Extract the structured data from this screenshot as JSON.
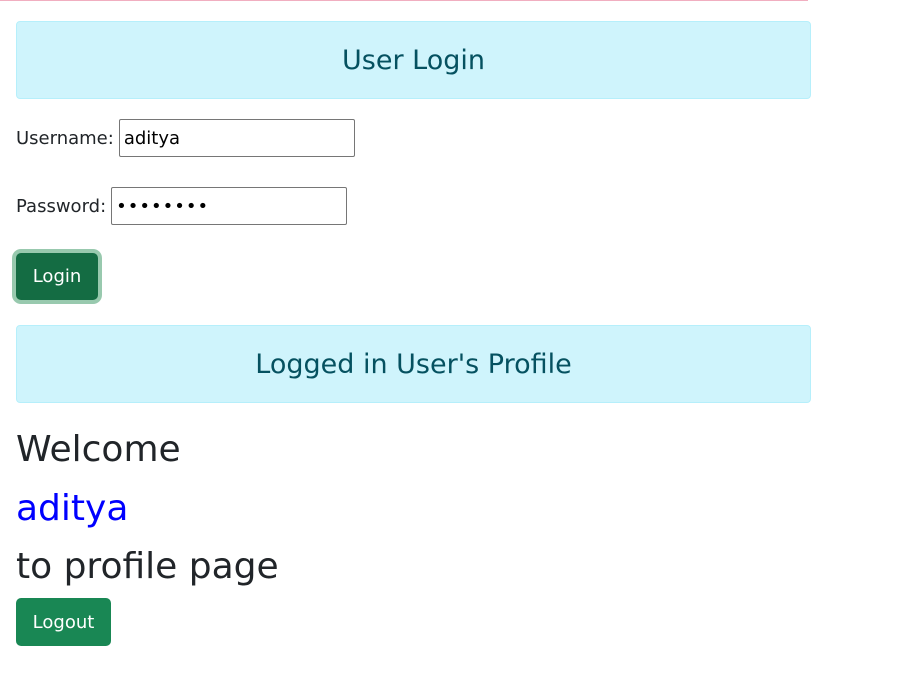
{
  "login_section": {
    "title": "User Login",
    "username_label": "Username:",
    "username_value": "aditya",
    "password_label": "Password:",
    "password_value": "••••••••",
    "login_button": "Login"
  },
  "profile_section": {
    "title": "Logged in User's Profile",
    "welcome_prefix": "Welcome",
    "welcome_name": "aditya",
    "welcome_suffix": "to profile page",
    "logout_button": "Logout"
  },
  "colors": {
    "banner_bg": "#cff4fc",
    "banner_text": "#055160",
    "username_highlight": "#0000ff",
    "button_green": "#198754"
  }
}
